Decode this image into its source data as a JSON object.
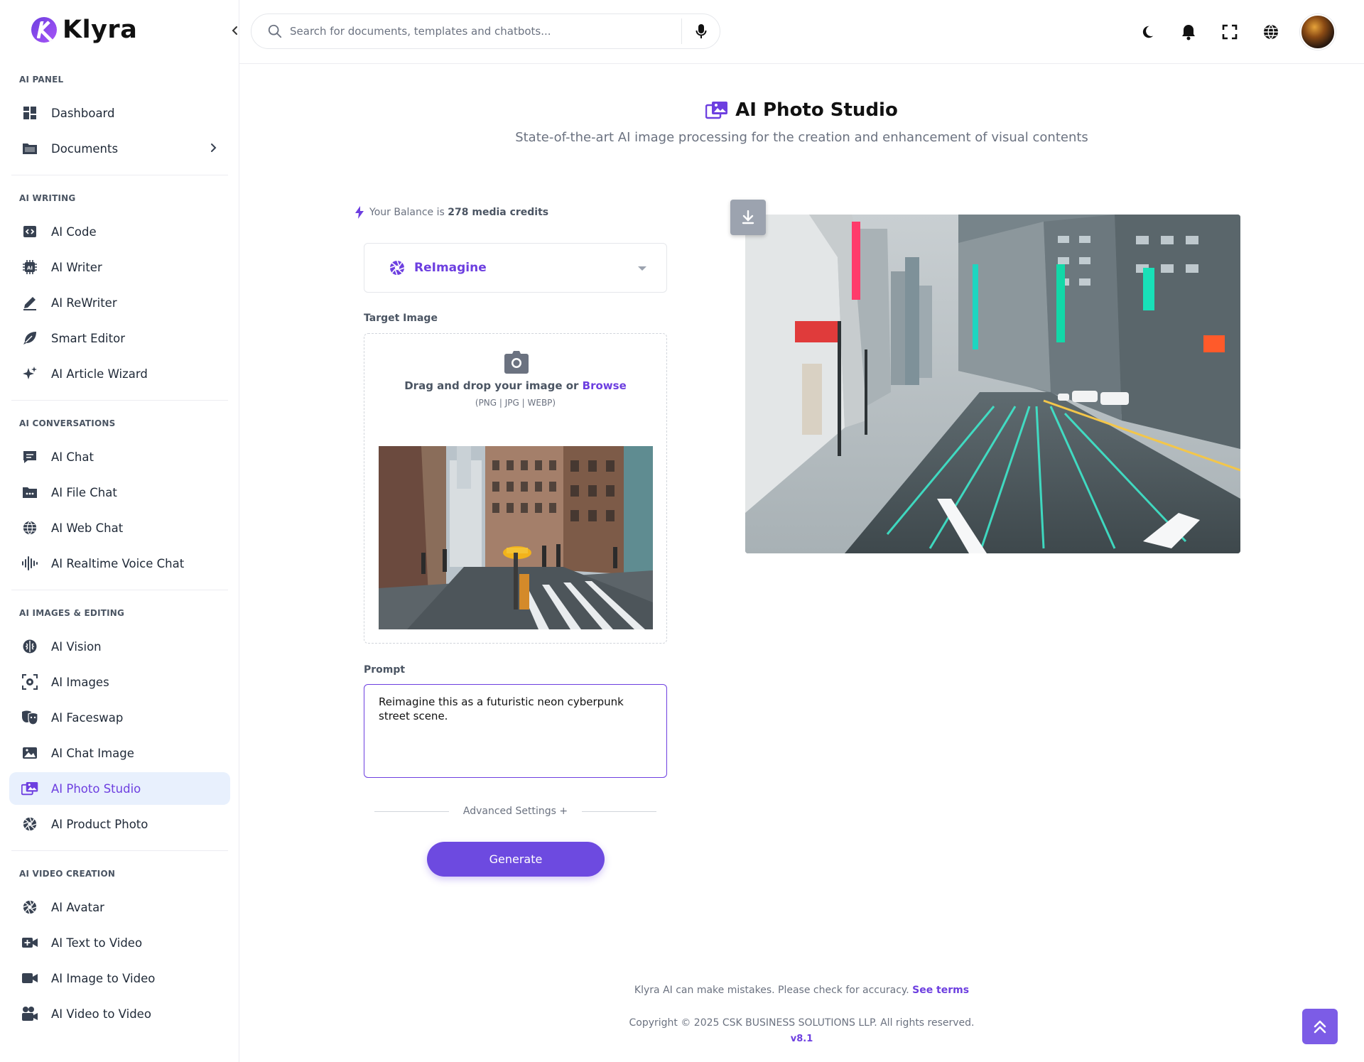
{
  "brand": {
    "name": "Klyra"
  },
  "sidebar": {
    "sections": [
      {
        "title": "AI PANEL",
        "items": [
          {
            "label": "Dashboard",
            "icon": "dashboard-icon"
          },
          {
            "label": "Documents",
            "icon": "folder-icon",
            "has_chevron": true
          }
        ]
      },
      {
        "title": "AI WRITING",
        "items": [
          {
            "label": "AI Code",
            "icon": "code-icon"
          },
          {
            "label": "AI Writer",
            "icon": "ai-chip-icon"
          },
          {
            "label": "AI ReWriter",
            "icon": "pen-icon"
          },
          {
            "label": "Smart Editor",
            "icon": "feather-icon"
          },
          {
            "label": "AI Article Wizard",
            "icon": "sparkles-icon"
          }
        ]
      },
      {
        "title": "AI CONVERSATIONS",
        "items": [
          {
            "label": "AI Chat",
            "icon": "chat-icon"
          },
          {
            "label": "AI File Chat",
            "icon": "file-chat-icon"
          },
          {
            "label": "AI Web Chat",
            "icon": "globe-icon"
          },
          {
            "label": "AI Realtime Voice Chat",
            "icon": "voice-wave-icon"
          }
        ]
      },
      {
        "title": "AI IMAGES & EDITING",
        "items": [
          {
            "label": "AI Vision",
            "icon": "brain-icon"
          },
          {
            "label": "AI Images",
            "icon": "image-scan-icon"
          },
          {
            "label": "AI Faceswap",
            "icon": "masks-icon"
          },
          {
            "label": "AI Chat Image",
            "icon": "image-icon"
          },
          {
            "label": "AI Photo Studio",
            "icon": "photo-studio-icon",
            "active": true
          },
          {
            "label": "AI Product Photo",
            "icon": "aperture-icon"
          }
        ]
      },
      {
        "title": "AI VIDEO CREATION",
        "items": [
          {
            "label": "AI Avatar",
            "icon": "aperture-icon"
          },
          {
            "label": "AI Text to Video",
            "icon": "video-plus-icon"
          },
          {
            "label": "AI Image to Video",
            "icon": "video-camera-icon"
          },
          {
            "label": "AI Video to Video",
            "icon": "video-reel-icon"
          }
        ]
      }
    ]
  },
  "search": {
    "placeholder": "Search for documents, templates and chatbots..."
  },
  "header": {
    "title": "AI Photo Studio",
    "subtitle": "State-of-the-art AI image processing for the creation and enhancement of visual contents"
  },
  "balance": {
    "prefix": "Your Balance is",
    "amount": "278 media credits"
  },
  "mode": {
    "selected": "ReImagine"
  },
  "target": {
    "label": "Target Image",
    "drop_text": "Drag and drop your image or",
    "browse": "Browse",
    "types": "(PNG | JPG | WEBP)"
  },
  "prompt": {
    "label": "Prompt",
    "value": "Reimagine this as a futuristic neon cyberpunk street scene."
  },
  "advanced": {
    "label": "Advanced Settings +"
  },
  "generate": {
    "label": "Generate"
  },
  "footer": {
    "note": "Klyra AI can make mistakes. Please check for accuracy.",
    "terms": "See terms",
    "copyright": "Copyright © 2025 CSK BUSINESS SOLUTIONS LLP. All rights reserved.",
    "version": "v8.1"
  },
  "colors": {
    "accent": "#6d3fe0",
    "active_bg": "#e8f0fd",
    "button": "#6d4ae0"
  }
}
